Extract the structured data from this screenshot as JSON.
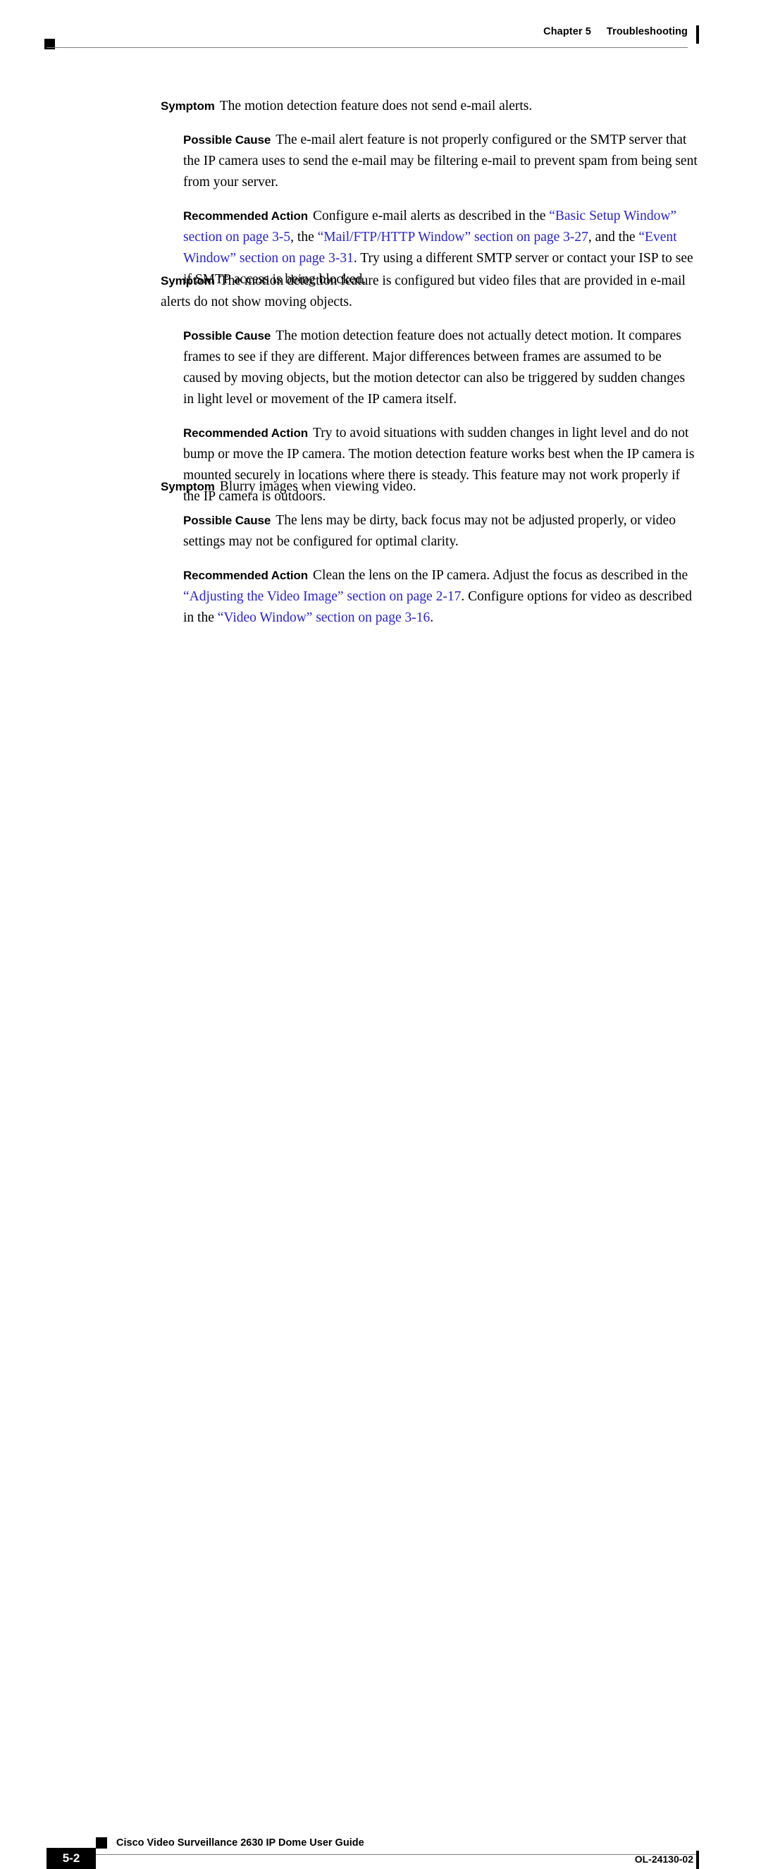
{
  "header": {
    "chapter": "Chapter 5",
    "section": "Troubleshooting"
  },
  "body": {
    "blocks": [
      {
        "symptom_label": "Symptom",
        "symptom_text": "The motion detection feature does not send e-mail alerts.",
        "cause_label": "Possible Cause",
        "cause_text": "The e-mail alert feature is not properly configured or the SMTP server that the IP camera uses to send the e-mail may be filtering e-mail to prevent spam from being sent from your server.",
        "action_label": "Recommended Action",
        "action_parts": [
          {
            "kind": "text",
            "text": "Configure e-mail alerts as described in the "
          },
          {
            "kind": "link",
            "text": "“Basic Setup Window” section on page 3-5"
          },
          {
            "kind": "text",
            "text": ", the "
          },
          {
            "kind": "link",
            "text": "“Mail/FTP/HTTP Window” section on page 3-27"
          },
          {
            "kind": "text",
            "text": ", and the "
          },
          {
            "kind": "link",
            "text": "“Event Window” section on page 3-31"
          },
          {
            "kind": "text",
            "text": ". Try using a different SMTP server or contact your ISP to see if SMTP access is being blocked."
          }
        ]
      },
      {
        "symptom_label": "Symptom",
        "symptom_text": "The motion detection feature is configured but video files that are provided in e-mail alerts do not show moving objects.",
        "cause_label": "Possible Cause",
        "cause_text": "The motion detection feature does not actually detect motion. It compares frames to see if they are different. Major differences between frames are assumed to be caused by moving objects, but the motion detector can also be triggered by sudden changes in light level or movement of the IP camera itself.",
        "action_label": "Recommended Action",
        "action_parts": [
          {
            "kind": "text",
            "text": "Try to avoid situations with sudden changes in light level and do not bump or move the IP camera. The motion detection feature works best when the IP camera is mounted securely in locations where there is steady. This feature may not work properly if the IP camera is outdoors."
          }
        ]
      },
      {
        "symptom_label": "Symptom",
        "symptom_text": "Blurry images when viewing video.",
        "cause_label": "Possible Cause",
        "cause_text": "The lens may be dirty, back focus may not be adjusted properly, or video settings may not be configured for optimal clarity.",
        "action_label": "Recommended Action",
        "action_parts": [
          {
            "kind": "text",
            "text": "Clean the lens on the IP camera. Adjust the focus as described in the "
          },
          {
            "kind": "link",
            "text": "“Adjusting the Video Image” section on page 2-17"
          },
          {
            "kind": "text",
            "text": ". Configure options for video as described in the "
          },
          {
            "kind": "link",
            "text": "“Video Window” section on page 3-16"
          },
          {
            "kind": "text",
            "text": "."
          }
        ]
      }
    ]
  },
  "footer": {
    "page_number": "5-2",
    "guide_title": "Cisco Video Surveillance 2630 IP Dome User Guide",
    "doc_id": "OL-24130-02"
  },
  "colors": {
    "link": "#2b24c8",
    "rule": "#808080",
    "text": "#000000"
  }
}
